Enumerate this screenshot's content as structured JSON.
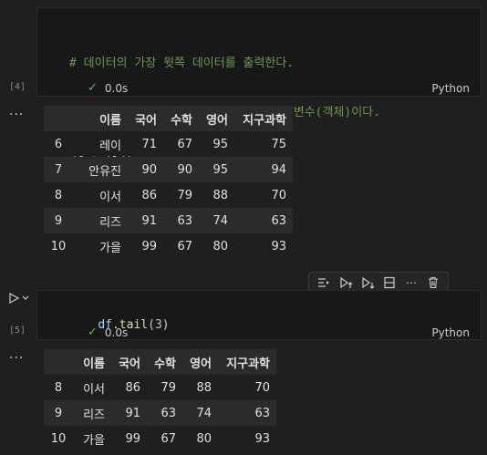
{
  "cell1": {
    "code": {
      "line1": "# 데이터의 가장 윗쪽 데이터를 출력한다.",
      "line2": "# 앞의 df는 데이터 프레임이 들어 있는 변수(객체)이다.",
      "line3_var": "df",
      "line3_dot": ".",
      "line3_fn": "tail",
      "line3_paren": "()"
    },
    "exec_count": "[4]",
    "status_time": "0.0s",
    "language": "Python",
    "table": {
      "headers": [
        "",
        "이름",
        "국어",
        "수학",
        "영어",
        "지구과학"
      ],
      "rows": [
        [
          "6",
          "레이",
          "71",
          "67",
          "95",
          "75"
        ],
        [
          "7",
          "안유진",
          "90",
          "90",
          "95",
          "94"
        ],
        [
          "8",
          "이서",
          "86",
          "79",
          "88",
          "70"
        ],
        [
          "9",
          "리즈",
          "91",
          "63",
          "74",
          "63"
        ],
        [
          "10",
          "가을",
          "99",
          "67",
          "80",
          "93"
        ]
      ]
    }
  },
  "cell2": {
    "code": {
      "var": "df",
      "dot": ".",
      "fn": "tail",
      "open": "(",
      "num": "3",
      "close": ")"
    },
    "exec_count": "[5]",
    "status_time": "0.0s",
    "language": "Python",
    "table": {
      "headers": [
        "",
        "이름",
        "국어",
        "수학",
        "영어",
        "지구과학"
      ],
      "rows": [
        [
          "8",
          "이서",
          "86",
          "79",
          "88",
          "70"
        ],
        [
          "9",
          "리즈",
          "91",
          "63",
          "74",
          "63"
        ],
        [
          "10",
          "가을",
          "99",
          "67",
          "80",
          "93"
        ]
      ]
    }
  },
  "output_menu": "...",
  "toolbar_icons": [
    "run-by-line-icon",
    "execute-above-icon",
    "execute-below-icon",
    "split-cell-icon",
    "more-icon",
    "delete-icon"
  ]
}
